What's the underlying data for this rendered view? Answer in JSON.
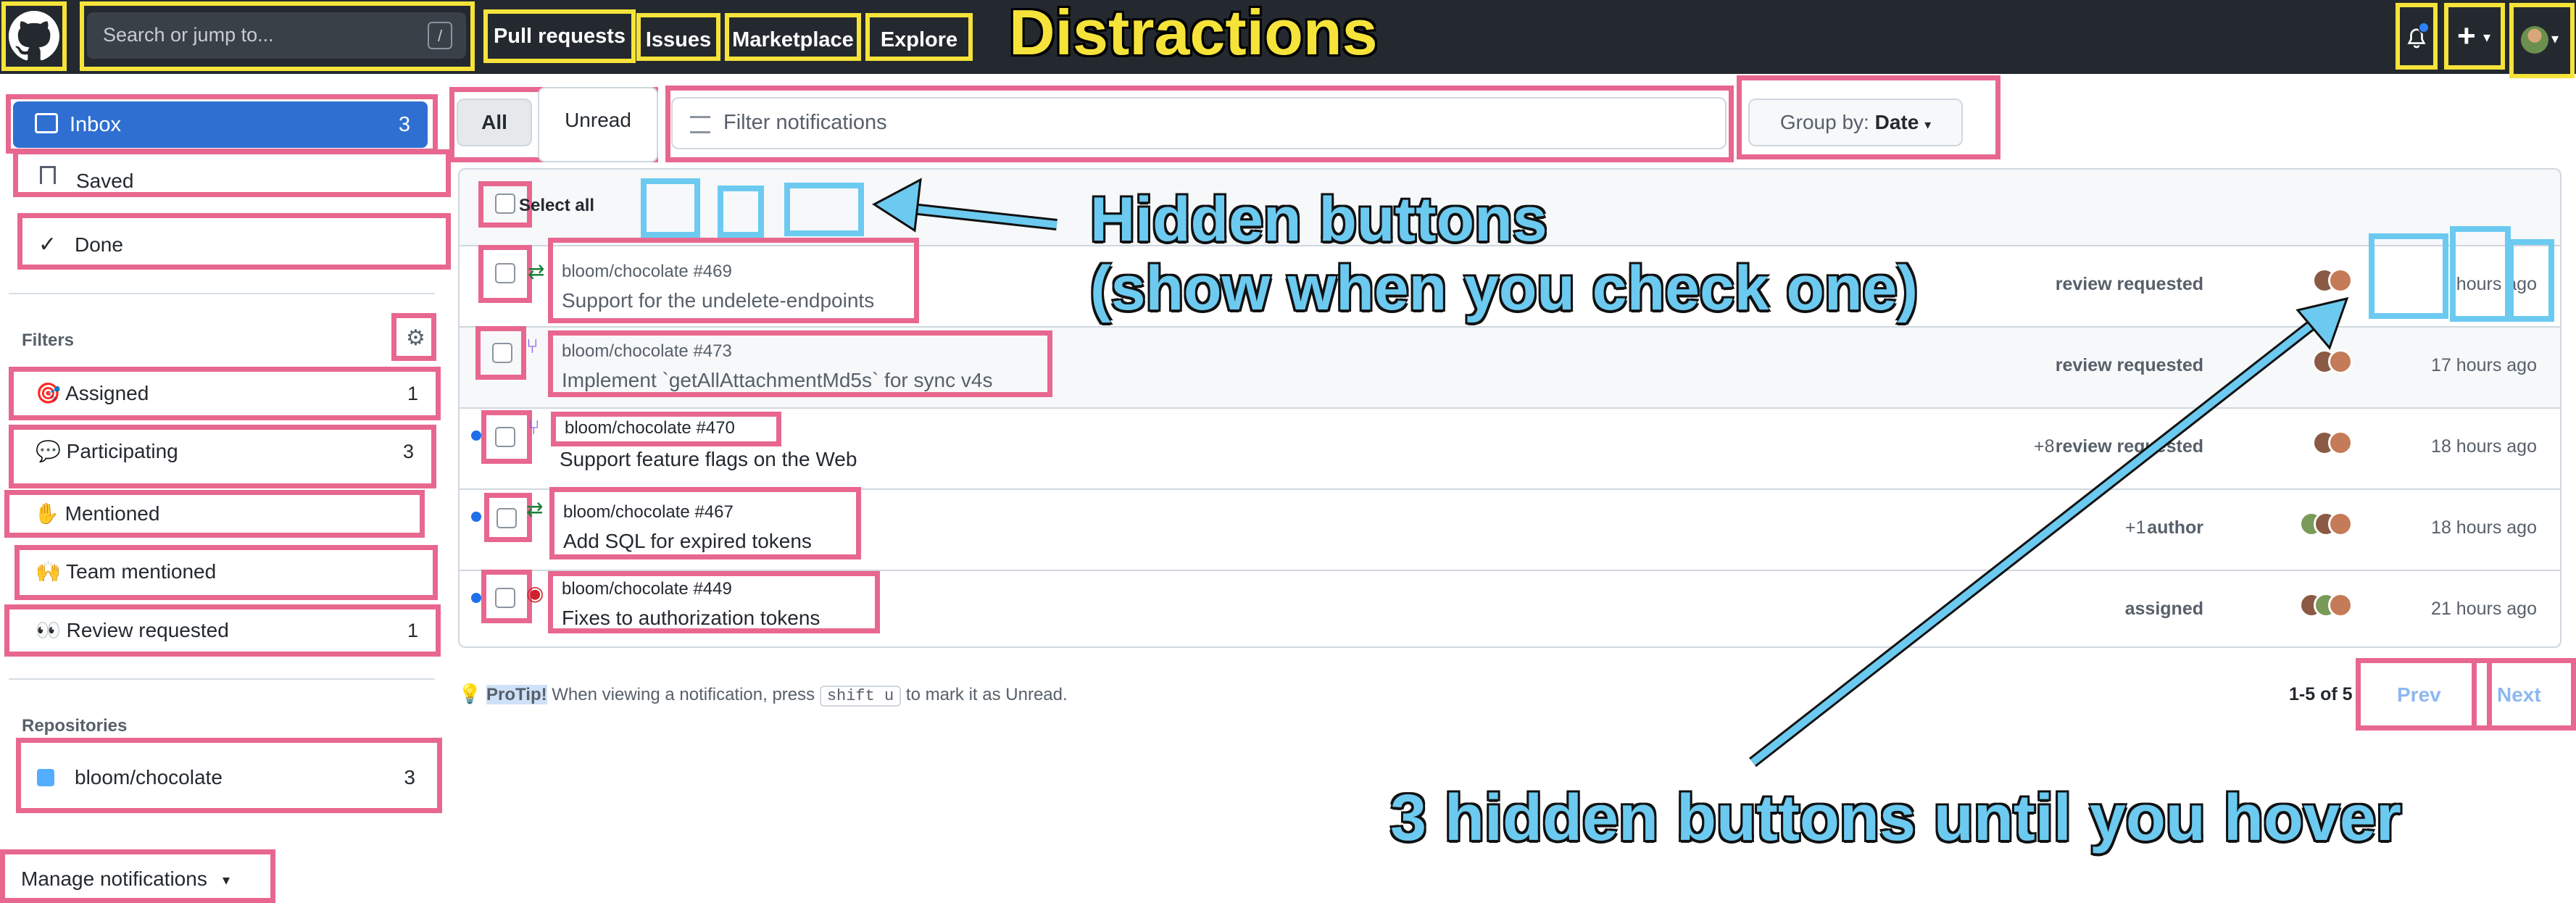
{
  "nav": {
    "search_placeholder": "Search or jump to...",
    "search_shortcut": "/",
    "links": [
      "Pull requests",
      "Issues",
      "Marketplace",
      "Explore"
    ]
  },
  "annotations": {
    "distractions": "Distractions",
    "hidden_buttons_line1": "Hidden buttons",
    "hidden_buttons_line2": "(show when you check one)",
    "hover_buttons": "3 hidden buttons until you hover"
  },
  "sidebar": {
    "inbox": {
      "label": "Inbox",
      "count": "3"
    },
    "saved": "Saved",
    "done": "Done",
    "filters_label": "Filters",
    "filters": [
      {
        "emoji": "🎯",
        "label": "Assigned",
        "count": "1"
      },
      {
        "emoji": "💬",
        "label": "Participating",
        "count": "3"
      },
      {
        "emoji": "✋",
        "label": "Mentioned",
        "count": ""
      },
      {
        "emoji": "🙌",
        "label": "Team mentioned",
        "count": ""
      },
      {
        "emoji": "👀",
        "label": "Review requested",
        "count": "1"
      }
    ],
    "repositories_label": "Repositories",
    "repo": {
      "label": "bloom/chocolate",
      "count": "3"
    },
    "manage": "Manage notifications"
  },
  "toolbar": {
    "all": "All",
    "unread": "Unread",
    "filter_placeholder": "Filter notifications",
    "group_by_label": "Group by:",
    "group_by_value": "Date"
  },
  "list": {
    "select_all": "Select all",
    "rows": [
      {
        "repo": "bloom/chocolate",
        "num": "#469",
        "title": "Support for the undelete-endpoints",
        "extra": "",
        "reason": "review requested",
        "time": "hours ago"
      },
      {
        "repo": "bloom/chocolate",
        "num": "#473",
        "title": "Implement `getAllAttachmentMd5s` for sync v4s",
        "extra": "",
        "reason": "review requested",
        "time": "17 hours ago"
      },
      {
        "repo": "bloom/chocolate",
        "num": "#470",
        "title": "Support feature flags on the Web",
        "extra": "+8",
        "reason": "review requested",
        "time": "18 hours ago"
      },
      {
        "repo": "bloom/chocolate",
        "num": "#467",
        "title": "Add SQL for expired tokens",
        "extra": "+1",
        "reason": "author",
        "time": "18 hours ago"
      },
      {
        "repo": "bloom/chocolate",
        "num": "#449",
        "title": "Fixes to authorization tokens",
        "extra": "",
        "reason": "assigned",
        "time": "21 hours ago"
      }
    ]
  },
  "footer": {
    "protip_label": "ProTip!",
    "protip_text1": "When viewing a notification, press",
    "protip_key": "shift u",
    "protip_text2": "to mark it as Unread.",
    "pagination": "1-5 of 5",
    "prev": "Prev",
    "next": "Next"
  }
}
